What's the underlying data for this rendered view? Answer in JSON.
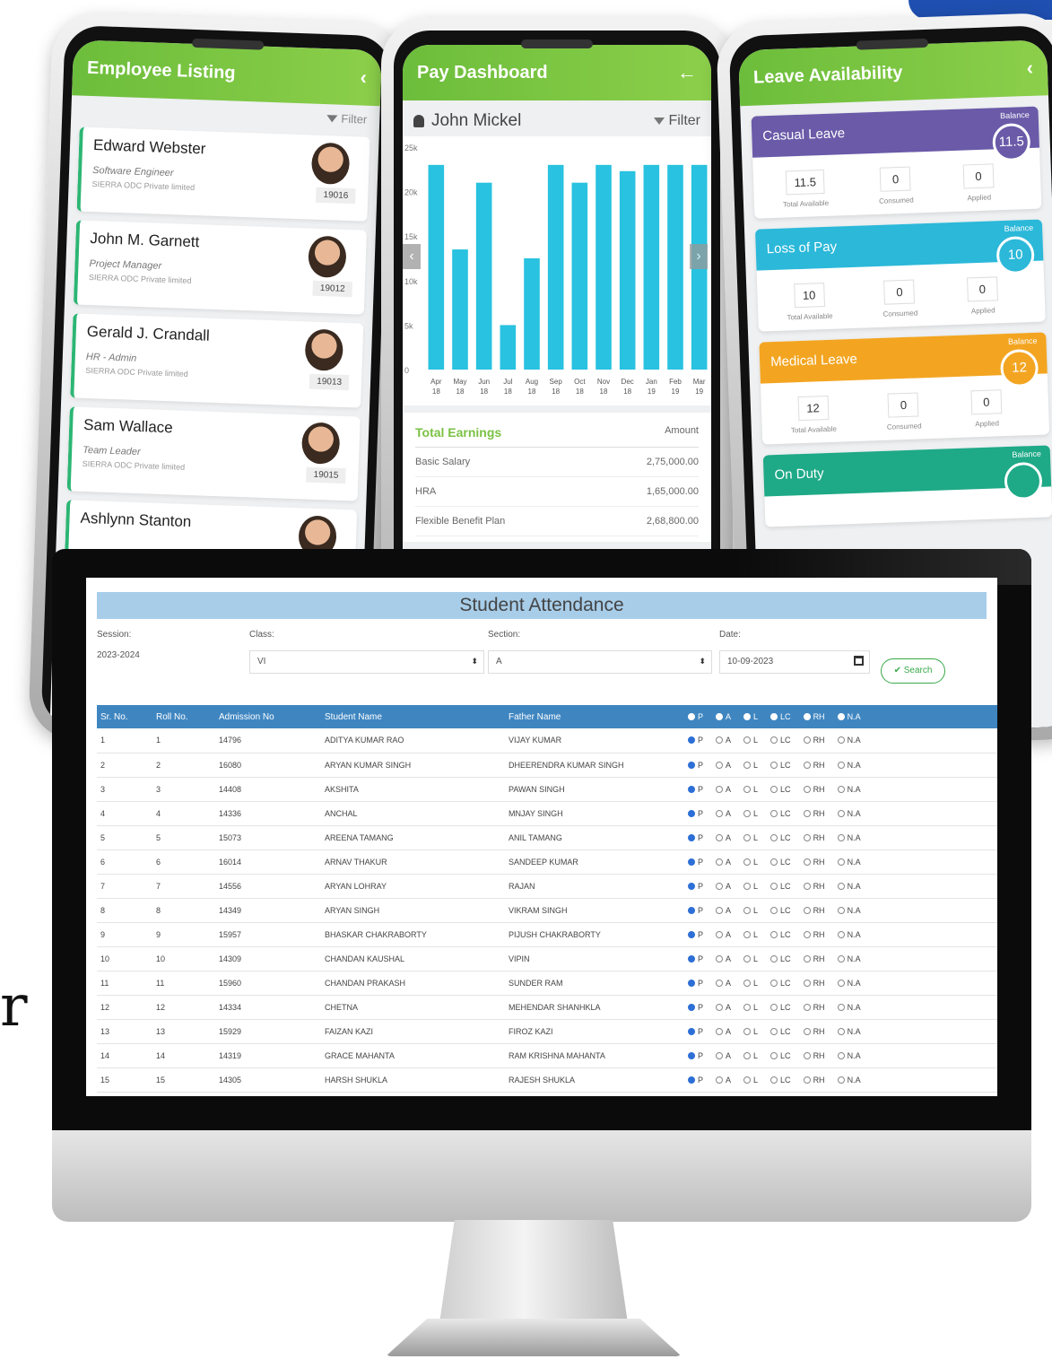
{
  "side_glyph": "r",
  "employee_app": {
    "title": "Employee Listing",
    "filter_label": "Filter",
    "employees": [
      {
        "name": "Edward Webster",
        "role": "Software Engineer",
        "company": "SIERRA ODC Private limited",
        "id": "19016"
      },
      {
        "name": "John M. Garnett",
        "role": "Project Manager",
        "company": "SIERRA ODC Private limited",
        "id": "19012"
      },
      {
        "name": "Gerald J. Crandall",
        "role": "HR - Admin",
        "company": "SIERRA ODC Private limited",
        "id": "19013"
      },
      {
        "name": "Sam Wallace",
        "role": "Team Leader",
        "company": "SIERRA ODC Private limited",
        "id": "19015"
      },
      {
        "name": "Ashlynn Stanton",
        "role": "",
        "company": "",
        "id": ""
      }
    ]
  },
  "pay_app": {
    "title": "Pay Dashboard",
    "user": "John Mickel",
    "filter_label": "Filter",
    "earnings_title": "Total Earnings",
    "amount_label": "Amount",
    "earnings": [
      {
        "label": "Basic Salary",
        "amount": "2,75,000.00"
      },
      {
        "label": "HRA",
        "amount": "1,65,000.00"
      },
      {
        "label": "Flexible Benefit Plan",
        "amount": "2,68,800.00"
      }
    ]
  },
  "chart_data": {
    "type": "bar",
    "categories": [
      "Apr 18",
      "May 18",
      "Jun 18",
      "Jul 18",
      "Aug 18",
      "Sep 18",
      "Oct 18",
      "Nov 18",
      "Dec 18",
      "Jan 19",
      "Feb 19",
      "Mar 19"
    ],
    "values": [
      23000,
      13500,
      21000,
      5000,
      12500,
      23000,
      21000,
      23000,
      22300,
      23000,
      23000,
      23000
    ],
    "ytick_labels": [
      "0",
      "5k",
      "10k",
      "15k",
      "20k",
      "25k"
    ],
    "ylim": [
      0,
      25000
    ],
    "color": "#29c2e0"
  },
  "leave_app": {
    "title": "Leave Availability",
    "balance_label": "Balance",
    "total_label": "Total Available",
    "consumed_label": "Consumed",
    "applied_label": "Applied",
    "leaves": [
      {
        "name": "Casual Leave",
        "balance": "11.5",
        "total": "11.5",
        "consumed": "0",
        "applied": "0",
        "color": "#6a5aa8"
      },
      {
        "name": "Loss of Pay",
        "balance": "10",
        "total": "10",
        "consumed": "0",
        "applied": "0",
        "color": "#2bb8d9"
      },
      {
        "name": "Medical Leave",
        "balance": "12",
        "total": "12",
        "consumed": "0",
        "applied": "0",
        "color": "#f3a521"
      },
      {
        "name": "On Duty",
        "balance": "",
        "total": "",
        "consumed": "",
        "applied": "",
        "color": "#1ea987"
      }
    ]
  },
  "attendance": {
    "title": "Student Attendance",
    "session_label": "Session:",
    "session_value": "2023-2024",
    "class_label": "Class:",
    "class_value": "VI",
    "section_label": "Section:",
    "section_value": "A",
    "date_label": "Date:",
    "date_value": "10-09-2023",
    "search_label": "Search",
    "columns": [
      "Sr. No.",
      "Roll No.",
      "Admission No",
      "Student Name",
      "Father Name"
    ],
    "status_options": [
      "P",
      "A",
      "L",
      "LC",
      "RH",
      "N.A"
    ],
    "rows": [
      {
        "sr": "1",
        "roll": "1",
        "adm": "14796",
        "student": "ADITYA KUMAR RAO",
        "father": "VIJAY KUMAR"
      },
      {
        "sr": "2",
        "roll": "2",
        "adm": "16080",
        "student": "ARYAN KUMAR SINGH",
        "father": "DHEERENDRA KUMAR SINGH"
      },
      {
        "sr": "3",
        "roll": "3",
        "adm": "14408",
        "student": "AKSHITA",
        "father": "PAWAN SINGH"
      },
      {
        "sr": "4",
        "roll": "4",
        "adm": "14336",
        "student": "ANCHAL",
        "father": "MNJAY SINGH"
      },
      {
        "sr": "5",
        "roll": "5",
        "adm": "15073",
        "student": "AREENA TAMANG",
        "father": "ANIL TAMANG"
      },
      {
        "sr": "6",
        "roll": "6",
        "adm": "16014",
        "student": "ARNAV THAKUR",
        "father": "SANDEEP KUMAR"
      },
      {
        "sr": "7",
        "roll": "7",
        "adm": "14556",
        "student": "ARYAN LOHRAY",
        "father": "RAJAN"
      },
      {
        "sr": "8",
        "roll": "8",
        "adm": "14349",
        "student": "ARYAN SINGH",
        "father": "VIKRAM SINGH"
      },
      {
        "sr": "9",
        "roll": "9",
        "adm": "15957",
        "student": "BHASKAR CHAKRABORTY",
        "father": "PIJUSH CHAKRABORTY"
      },
      {
        "sr": "10",
        "roll": "10",
        "adm": "14309",
        "student": "CHANDAN KAUSHAL",
        "father": "VIPIN"
      },
      {
        "sr": "11",
        "roll": "11",
        "adm": "15960",
        "student": "CHANDAN PRAKASH",
        "father": "SUNDER RAM"
      },
      {
        "sr": "12",
        "roll": "12",
        "adm": "14334",
        "student": "CHETNA",
        "father": "MEHENDAR SHANHKLA"
      },
      {
        "sr": "13",
        "roll": "13",
        "adm": "15929",
        "student": "FAIZAN KAZI",
        "father": "FIROZ KAZI"
      },
      {
        "sr": "14",
        "roll": "14",
        "adm": "14319",
        "student": "GRACE MAHANTA",
        "father": "RAM KRISHNA MAHANTA"
      },
      {
        "sr": "15",
        "roll": "15",
        "adm": "14305",
        "student": "HARSH SHUKLA",
        "father": "RAJESH SHUKLA"
      }
    ]
  }
}
